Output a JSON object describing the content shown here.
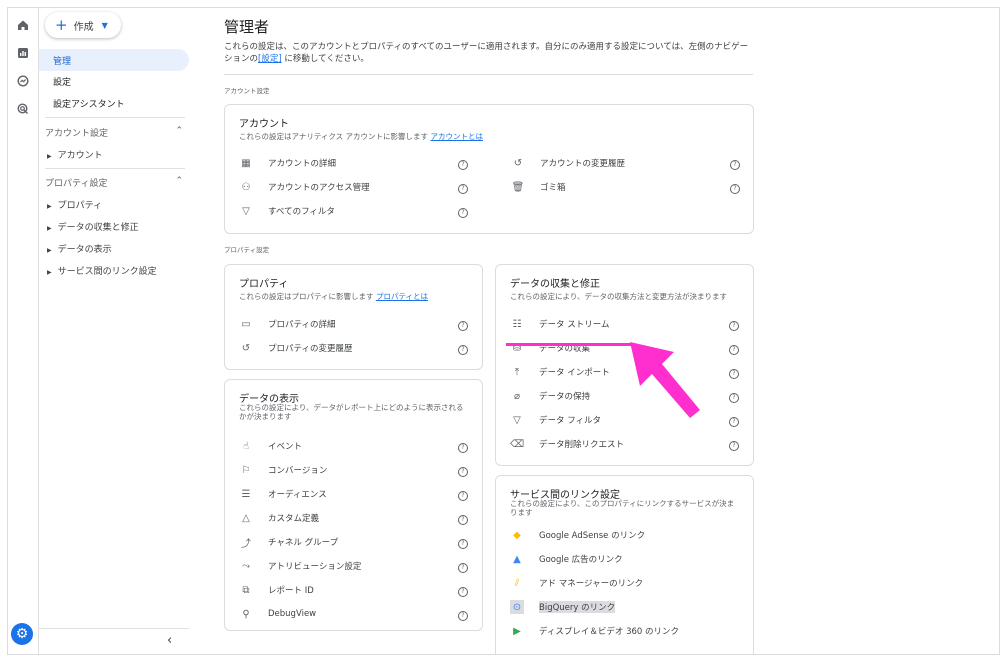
{
  "colors": {
    "accent": "#1a73e8",
    "annotation": "#ff2ecf"
  },
  "rail": {
    "icons": [
      "home-icon",
      "reports-icon",
      "explore-icon",
      "advertising-icon"
    ],
    "settings_icon": "gear-icon"
  },
  "sidebar": {
    "create_label": "作成",
    "items": [
      "管理",
      "設定",
      "設定アシスタント"
    ],
    "account_section": {
      "label": "アカウント設定",
      "children": [
        "アカウント"
      ]
    },
    "property_section": {
      "label": "プロパティ設定",
      "children": [
        "プロパティ",
        "データの収集と修正",
        "データの表示",
        "サービス間のリンク設定"
      ]
    },
    "collapse_icon": "‹"
  },
  "main": {
    "title": "管理者",
    "desc_1": "これらの設定は、このアカウントとプロパティのすべてのユーザーに適用されます。自分にのみ適用する設定については、左側のナビゲー",
    "desc_2a": "ションの",
    "desc_link": "[設定]",
    "desc_2b": " に移動してください。",
    "account_settings_label": "アカウント設定",
    "property_settings_label": "プロパティ設定",
    "account_card": {
      "title": "アカウント",
      "sub": "これらの設定はアナリティクス アカウントに影響します",
      "sub_link": "アカウントとは",
      "left": [
        "アカウントの詳細",
        "アカウントのアクセス管理",
        "すべてのフィルタ"
      ],
      "right": [
        "アカウントの変更履歴",
        "ゴミ箱"
      ]
    },
    "property_card": {
      "title": "プロパティ",
      "sub": "これらの設定はプロパティに影響します",
      "sub_link": "プロパティとは",
      "items": [
        "プロパティの詳細",
        "プロパティの変更履歴"
      ]
    },
    "display_card": {
      "title": "データの表示",
      "sub_1": "これらの設定により、データがレポート上にどのように表示される",
      "sub_2": "かが決まります",
      "items": [
        "イベント",
        "コンバージョン",
        "オーディエンス",
        "カスタム定義",
        "チャネル グループ",
        "アトリビューション設定",
        "レポート ID",
        "DebugView"
      ]
    },
    "collection_card": {
      "title": "データの収集と修正",
      "sub": "これらの設定により、データの収集方法と変更方法が決まります",
      "items": [
        "データ ストリーム",
        "データの収集",
        "データ インポート",
        "データの保持",
        "データ フィルタ",
        "データ削除リクエスト"
      ]
    },
    "links_card": {
      "title": "サービス間のリンク設定",
      "sub_1": "これらの設定により、このプロパティにリンクするサービスが決ま",
      "sub_2": "ります",
      "items": [
        "Google AdSense のリンク",
        "Google 広告のリンク",
        "アド マネージャーのリンク",
        "BigQuery のリンク",
        "ディスプレイ＆ビデオ 360 のリンク"
      ]
    }
  }
}
